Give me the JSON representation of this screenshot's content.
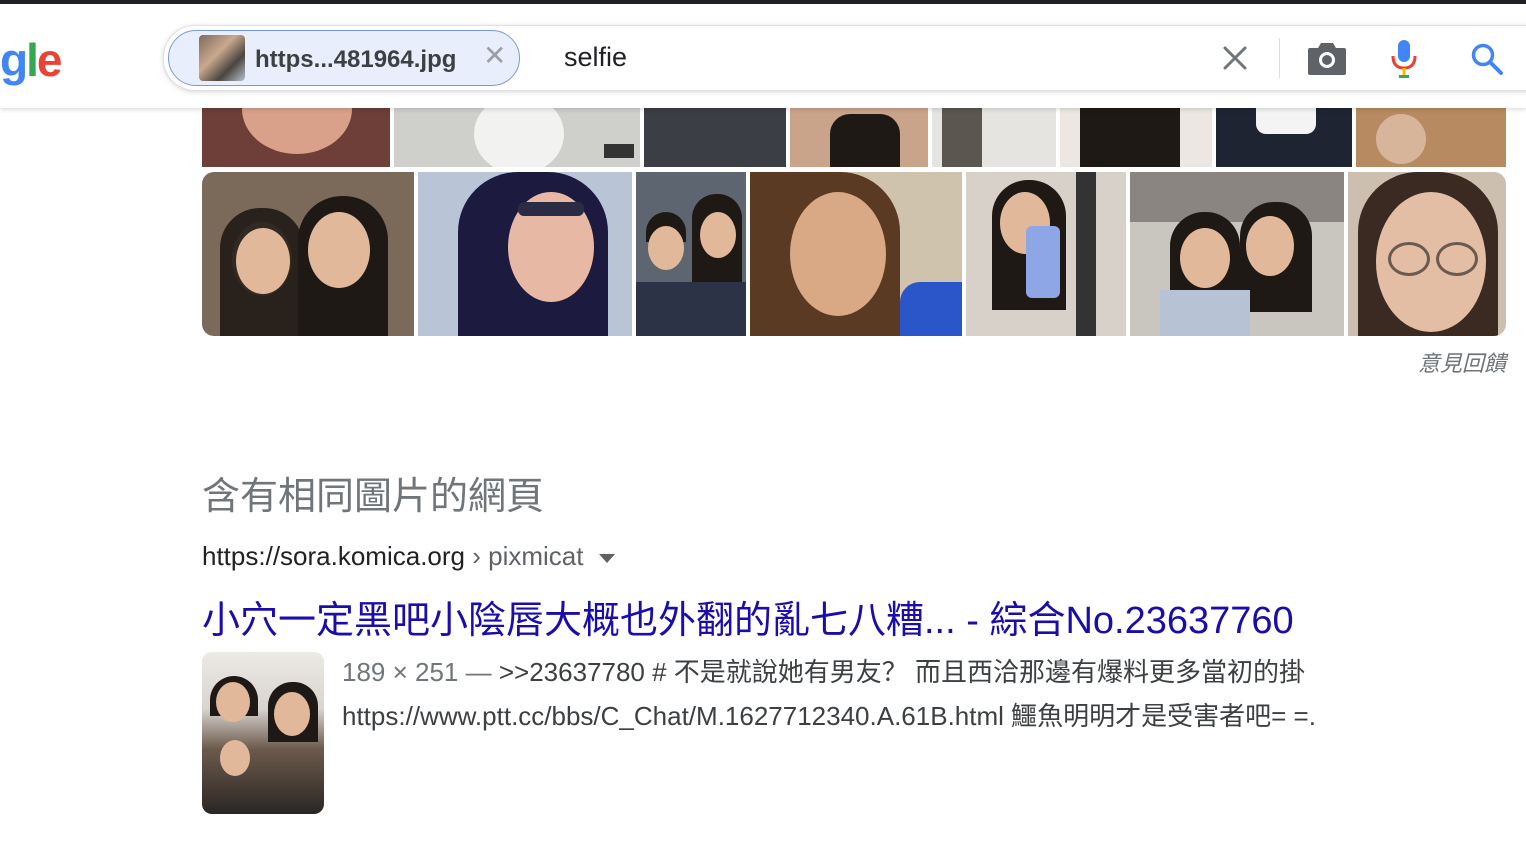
{
  "header": {
    "logo_partial": [
      "g",
      "l",
      "e"
    ],
    "image_chip_label": "https...481964.jpg",
    "chip_close_glyph": "✕",
    "query": "selfie",
    "icons": [
      "clear-icon",
      "camera-icon",
      "mic-icon",
      "search-icon"
    ]
  },
  "similar_images": {
    "feedback_label": "意見回饋",
    "tile_count": 15
  },
  "pages_section": {
    "title": "含有相同圖片的網頁"
  },
  "result": {
    "domain": "https://sora.komica.org",
    "separator": " › ",
    "path": "pixmicat",
    "title": "小穴一定黑吧小陰唇大概也外翻的亂七八糟... - 綜合No.23637760",
    "dimensions": "189 × 251 — ",
    "snippet_line1": ">>23637780 # 不是就說她有男友？ 而且西洽那邊有爆料更多當初的掛",
    "snippet_line2": "https://www.ptt.cc/bbs/C_Chat/M.1627712340.A.61B.html 鱷魚明明才是受害者吧= =."
  },
  "colors": {
    "link": "#1a0dab",
    "google_blue": "#4285f4",
    "google_green": "#34a853",
    "google_red": "#ea4335",
    "google_yellow": "#fbbc05"
  }
}
